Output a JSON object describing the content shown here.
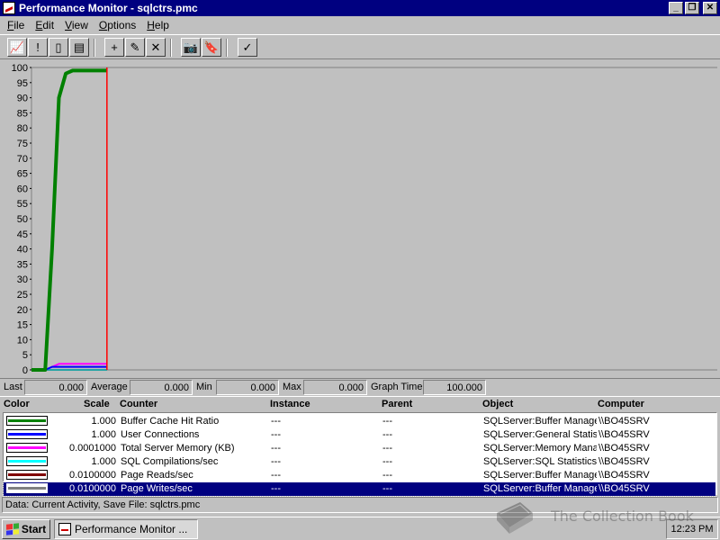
{
  "window": {
    "title": "Performance Monitor - sqlctrs.pmc",
    "buttons": {
      "minimize": "_",
      "restore": "❐",
      "close": "✕"
    }
  },
  "menu": [
    "File",
    "Edit",
    "View",
    "Options",
    "Help"
  ],
  "menu_mnemonics": [
    "F",
    "E",
    "V",
    "O",
    "H"
  ],
  "toolbar": {
    "buttons": [
      {
        "name": "chart-view",
        "glyph": "📈"
      },
      {
        "name": "alert-view",
        "glyph": "!"
      },
      {
        "name": "log-view",
        "glyph": "▯"
      },
      {
        "name": "report-view",
        "glyph": "▤"
      },
      {
        "name": "add-counter",
        "glyph": "+"
      },
      {
        "name": "edit-counter",
        "glyph": "✎"
      },
      {
        "name": "delete-counter",
        "glyph": "✕"
      },
      {
        "name": "update-now",
        "glyph": "📷"
      },
      {
        "name": "place-bookmark",
        "glyph": "🔖"
      },
      {
        "name": "options",
        "glyph": "✓"
      }
    ]
  },
  "chart_data": {
    "type": "line",
    "title": "",
    "xlabel": "",
    "ylabel": "",
    "ylim": [
      0,
      100
    ],
    "yticks": [
      0,
      5,
      10,
      15,
      20,
      25,
      30,
      35,
      40,
      45,
      50,
      55,
      60,
      65,
      70,
      75,
      80,
      85,
      90,
      95,
      100
    ],
    "x_range": [
      0,
      100
    ],
    "current_position_x": 11,
    "series": [
      {
        "name": "Buffer Cache Hit Ratio",
        "color": "#008000",
        "x": [
          0,
          2,
          3,
          4,
          5,
          6,
          11
        ],
        "y": [
          0,
          0,
          40,
          90,
          98,
          99,
          99
        ]
      },
      {
        "name": "User Connections",
        "color": "#0000ff",
        "x": [
          0,
          2,
          3,
          11
        ],
        "y": [
          0,
          0,
          1,
          1
        ]
      },
      {
        "name": "Total Server Memory (KB)",
        "color": "#ff00ff",
        "x": [
          0,
          2,
          3,
          4,
          11
        ],
        "y": [
          0,
          0,
          1,
          2,
          2
        ]
      },
      {
        "name": "SQL Compilations/sec",
        "color": "#00c0c0",
        "x": [
          0,
          11
        ],
        "y": [
          0,
          0
        ]
      },
      {
        "name": "Page Reads/sec",
        "color": "#800000",
        "x": [
          0,
          11
        ],
        "y": [
          0,
          0
        ]
      },
      {
        "name": "Page Writes/sec",
        "color": "#808080",
        "x": [
          0,
          11
        ],
        "y": [
          0,
          0
        ]
      }
    ],
    "grid": false
  },
  "stats": {
    "last_label": "Last",
    "last": "0.000",
    "average_label": "Average",
    "average": "0.000",
    "min_label": "Min",
    "min": "0.000",
    "max_label": "Max",
    "max": "0.000",
    "graph_time_label": "Graph Time",
    "graph_time": "100.000"
  },
  "legend": {
    "headers": {
      "color": "Color",
      "scale": "Scale",
      "counter": "Counter",
      "instance": "Instance",
      "parent": "Parent",
      "object": "Object",
      "computer": "Computer"
    },
    "rows": [
      {
        "color": "#008000",
        "scale": "1.000",
        "counter": "Buffer Cache Hit Ratio",
        "instance": "---",
        "parent": "---",
        "object": "SQLServer:Buffer Manage",
        "computer": "\\\\BO45SRV"
      },
      {
        "color": "#0000ff",
        "scale": "1.000",
        "counter": "User Connections",
        "instance": "---",
        "parent": "---",
        "object": "SQLServer:General Statist",
        "computer": "\\\\BO45SRV"
      },
      {
        "color": "#ff00ff",
        "scale": "0.0001000",
        "counter": "Total Server Memory (KB)",
        "instance": "---",
        "parent": "---",
        "object": "SQLServer:Memory Manag",
        "computer": "\\\\BO45SRV"
      },
      {
        "color": "#00ffff",
        "scale": "1.000",
        "counter": "SQL Compilations/sec",
        "instance": "---",
        "parent": "---",
        "object": "SQLServer:SQL Statistics",
        "computer": "\\\\BO45SRV"
      },
      {
        "color": "#800000",
        "scale": "0.0100000",
        "counter": "Page Reads/sec",
        "instance": "---",
        "parent": "---",
        "object": "SQLServer:Buffer Manage",
        "computer": "\\\\BO45SRV"
      },
      {
        "color": "#808080",
        "scale": "0.0100000",
        "counter": "Page Writes/sec",
        "instance": "---",
        "parent": "---",
        "object": "SQLServer:Buffer Manage",
        "computer": "\\\\BO45SRV",
        "selected": true
      }
    ]
  },
  "statusbar": {
    "text": "Data: Current Activity, Save File: sqlctrs.pmc"
  },
  "taskbar": {
    "start_label": "Start",
    "task_label": "Performance Monitor ...",
    "clock": "12:23 PM"
  },
  "watermark": {
    "text": "The Collection Book"
  }
}
